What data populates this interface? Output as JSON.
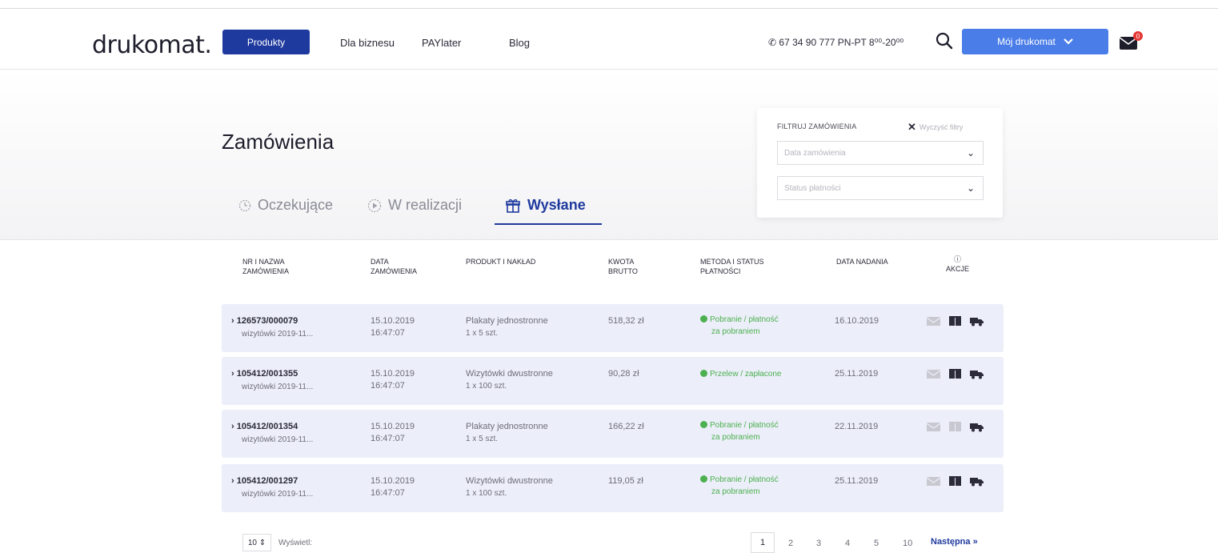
{
  "header": {
    "logo": "drukomat.",
    "nav": [
      "Produkty",
      "Dla biznesu",
      "PAYlater",
      "Blog"
    ],
    "phone": "67 34 90 777  PN-PT 8⁰⁰-20⁰⁰",
    "account": "Mój drukomat",
    "mail_badge": "0"
  },
  "page": {
    "title": "Zamówienia",
    "tabs": [
      "Oczekujące",
      "W realizacji",
      "Wysłane"
    ],
    "active_tab": "Wysłane"
  },
  "filter": {
    "title": "FILTRUJ ZAMÓWIENIA",
    "clear": "Wyczyść filtry",
    "date_placeholder": "Data zamówienia",
    "status_placeholder": "Status płatności"
  },
  "table": {
    "columns": [
      "NR I NAZWA ZAMÓWIENIA",
      "DATA ZAMÓWIENIA",
      "PRODUKT I NAKŁAD",
      "KWOTA BRUTTO",
      "METODA I STATUS PŁATNOŚCI",
      "DATA NADANIA",
      "AKCJE"
    ],
    "rows": [
      {
        "nr": "126573/000079",
        "name": "wizytówki 2019-11...",
        "date": "15.10.2019",
        "time": "16:47:07",
        "product": "Plakaty jednostronne",
        "qty": "1 x 5 szt.",
        "amount": "518,32 zł",
        "status": "Pobranie / płatność",
        "status2": "za pobraniem",
        "sent": "16.10.2019"
      },
      {
        "nr": "105412/001355",
        "name": "wizytówki 2019-11...",
        "date": "15.10.2019",
        "time": "16:47:07",
        "product": "Wizytówki dwustronne",
        "qty": "1 x 100 szt.",
        "amount": "90,28 zł",
        "status": "Przelew / zapłacone",
        "status2": "",
        "sent": "25.11.2019"
      },
      {
        "nr": "105412/001354",
        "name": "wizytówki 2019-11...",
        "date": "15.10.2019",
        "time": "16:47:07",
        "product": "Plakaty jednostronne",
        "qty": "1 x 5 szt.",
        "amount": "166,22 zł",
        "status": "Pobranie / płatność",
        "status2": "za pobraniem",
        "sent": "22.11.2019"
      },
      {
        "nr": "105412/001297",
        "name": "wizytówki 2019-11...",
        "date": "15.10.2019",
        "time": "16:47:07",
        "product": "Wizytówki dwustronne",
        "qty": "1 x 100 szt.",
        "amount": "119,05 zł",
        "status": "Pobranie / płatność",
        "status2": "za pobraniem",
        "sent": "25.11.2019"
      }
    ]
  },
  "pagination": {
    "per_page": "10",
    "per_page_label": "Wyświetl:",
    "pages": [
      "1",
      "2",
      "3",
      "4",
      "5",
      "10"
    ],
    "current": "1",
    "next": "Następna"
  },
  "colors": {
    "primary": "#1f3a9e",
    "account": "#4a7de8",
    "row_bg": "#eceef9",
    "status_green": "#4cb050",
    "badge_red": "#e53935"
  }
}
